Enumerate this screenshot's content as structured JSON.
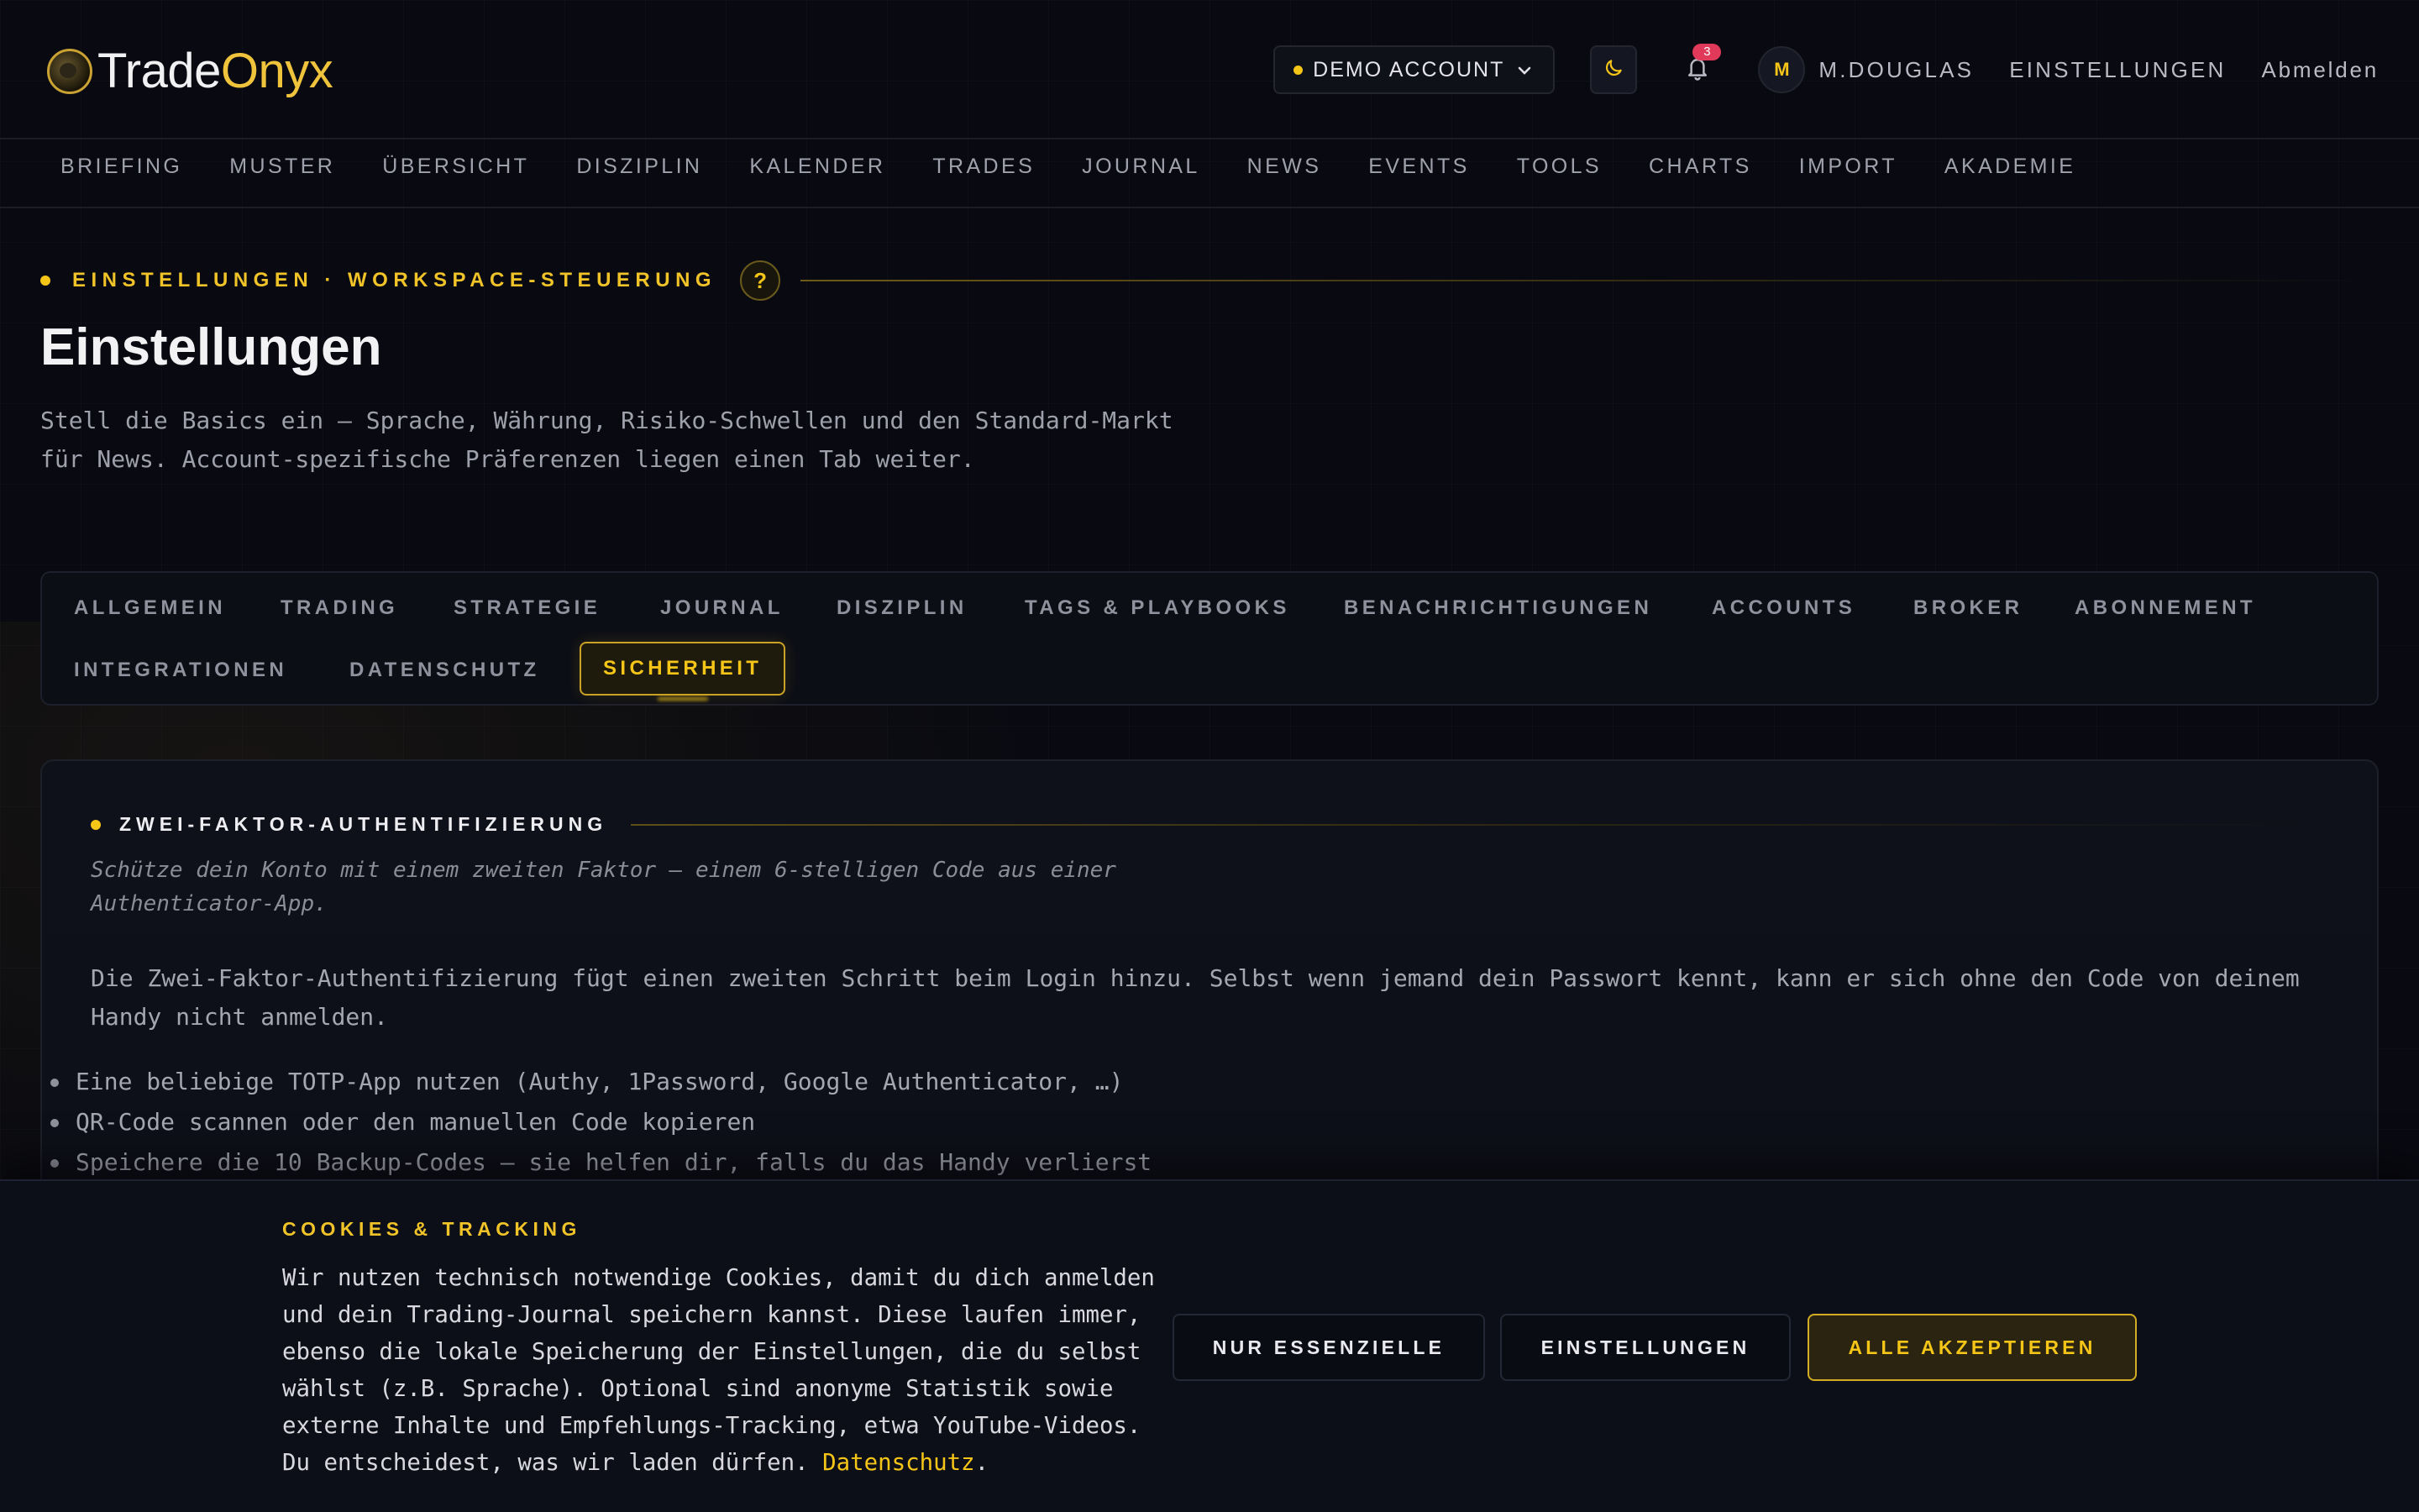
{
  "app": {
    "name_part1": "Trade",
    "name_part2": "Onyx"
  },
  "header": {
    "account": "DEMO ACCOUNT",
    "notification_count": "3",
    "avatar_initial": "M",
    "username": "M.DOUGLAS",
    "settings_link": "EINSTELLUNGEN",
    "logout_link": "Abmelden"
  },
  "nav": {
    "items": [
      "BRIEFING",
      "MUSTER",
      "ÜBERSICHT",
      "DISZIPLIN",
      "KALENDER",
      "TRADES",
      "JOURNAL",
      "NEWS",
      "EVENTS",
      "TOOLS",
      "CHARTS",
      "IMPORT",
      "AKADEMIE"
    ]
  },
  "page": {
    "eyebrow": "EINSTELLUNGEN · WORKSPACE-STEUERUNG",
    "help": "?",
    "title": "Einstellungen",
    "description": "Stell die Basics ein — Sprache, Währung, Risiko-Schwellen und den Standard-Markt für News. Account-spezifische Präferenzen liegen einen Tab weiter."
  },
  "tabs": {
    "items": [
      "ALLGEMEIN",
      "TRADING",
      "STRATEGIE",
      "JOURNAL",
      "DISZIPLIN",
      "TAGS & PLAYBOOKS",
      "BENACHRICHTIGUNGEN",
      "ACCOUNTS",
      "BROKER",
      "ABONNEMENT",
      "INTEGRATIONEN",
      "DATENSCHUTZ",
      "SICHERHEIT"
    ],
    "active": "SICHERHEIT"
  },
  "twofa": {
    "title": "ZWEI-FAKTOR-AUTHENTIFIZIERUNG",
    "subtitle": "Schütze dein Konto mit einem zweiten Faktor — einem 6-stelligen Code aus einer Authenticator-App.",
    "body": "Die Zwei-Faktor-Authentifizierung fügt einen zweiten Schritt beim Login hinzu. Selbst wenn jemand dein Passwort kennt, kann er sich ohne den Code von deinem Handy nicht anmelden.",
    "bullets": [
      "Eine beliebige TOTP-App nutzen (Authy, 1Password, Google Authenticator, …)",
      "QR-Code scannen oder den manuellen Code kopieren",
      "Speichere die 10 Backup-Codes — sie helfen dir, falls du das Handy verlierst"
    ]
  },
  "cookie": {
    "title": "COOKIES & TRACKING",
    "text": "Wir nutzen technisch notwendige Cookies, damit du dich anmelden und dein Trading-Journal speichern kannst. Diese laufen immer, ebenso die lokale Speicherung der Einstellungen, die du selbst wählst (z.B. Sprache). Optional sind anonyme Statistik sowie externe Inhalte und Empfehlungs-Tracking, etwa YouTube-Videos. Du entscheidest, was wir laden dürfen.",
    "link": "Datenschutz",
    "period": ".",
    "btn_essential": "NUR ESSENZIELLE",
    "btn_settings": "EINSTELLUNGEN",
    "btn_accept": "ALLE AKZEPTIEREN"
  },
  "colors": {
    "accent": "#f5c518",
    "background": "#090a11",
    "badge": "#e0395a"
  }
}
